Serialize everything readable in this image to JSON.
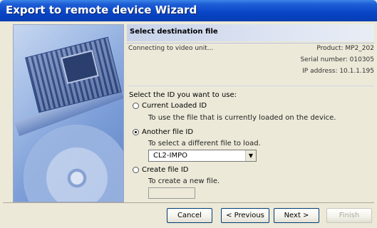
{
  "window": {
    "title": "Export to remote device Wizard"
  },
  "header": {
    "title": "Select destination file"
  },
  "connection": {
    "status": "Connecting to video unit...",
    "product": "Product: MP2_202",
    "serial": "Serial number: 010305",
    "ip": "IP address: 10.1.1.195"
  },
  "selection": {
    "prompt": "Select the ID you want to use:",
    "options": [
      {
        "label": "Current Loaded ID",
        "description": "To use the file that is currently loaded on the device.",
        "selected": false
      },
      {
        "label": "Another file ID",
        "description": "To select a different file to load.",
        "selected": true
      },
      {
        "label": "Create file ID",
        "description": "To create a new file.",
        "selected": false
      }
    ],
    "file_combo_value": "CL2-IMPO",
    "new_file_value": ""
  },
  "buttons": {
    "cancel": "Cancel",
    "previous": "< Previous",
    "next": "Next >",
    "finish": "Finish"
  },
  "colors": {
    "titlebar": "#0a47c8",
    "window_bg": "#ece9d8",
    "header_bar": "#c7d2ea"
  }
}
